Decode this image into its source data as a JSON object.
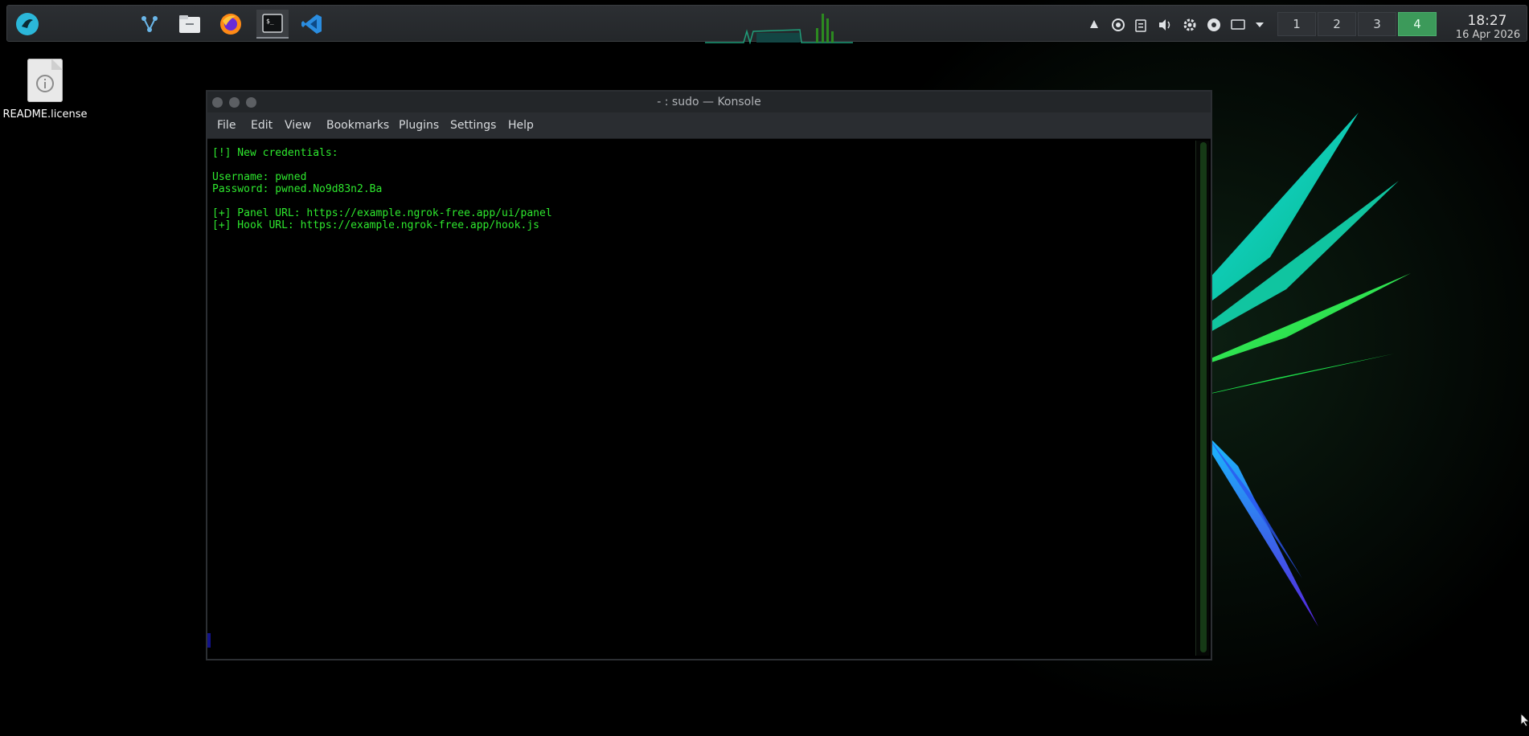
{
  "taskbar": {
    "launcher_icon": "bird-launcher-icon",
    "apps": [
      {
        "name": "network-tool-icon"
      },
      {
        "name": "file-manager-icon"
      },
      {
        "name": "firefox-icon"
      },
      {
        "name": "terminal-icon",
        "active": true
      },
      {
        "name": "vscode-icon"
      }
    ],
    "tray_icons": [
      "notification-icon",
      "update-icon",
      "clipboard-icon",
      "volume-icon",
      "settings-icon",
      "record-icon",
      "display-icon",
      "expand-icon"
    ],
    "desktops": [
      "1",
      "2",
      "3",
      "4"
    ],
    "active_desktop": "4",
    "clock_time": "18:27",
    "clock_date": "16 Apr 2026"
  },
  "desktop": {
    "file_label": "README.license"
  },
  "window": {
    "title": "- : sudo — Konsole",
    "menu": [
      "File",
      "Edit",
      "View",
      "Bookmarks",
      "Plugins",
      "Settings",
      "Help"
    ]
  },
  "terminal": {
    "lines": [
      "[!] New credentials:",
      "",
      "Username: pwned",
      "Password: pwned.No9d83n2.Ba",
      "",
      "[+] Panel URL: https://example.ngrok-free.app/ui/panel",
      "[+] Hook URL: https://example.ngrok-free.app/hook.js"
    ]
  },
  "colors": {
    "terminal_text": "#2ee82e",
    "active_desktop": "#3c9a5a",
    "panel_bg": "#2c2f33"
  }
}
